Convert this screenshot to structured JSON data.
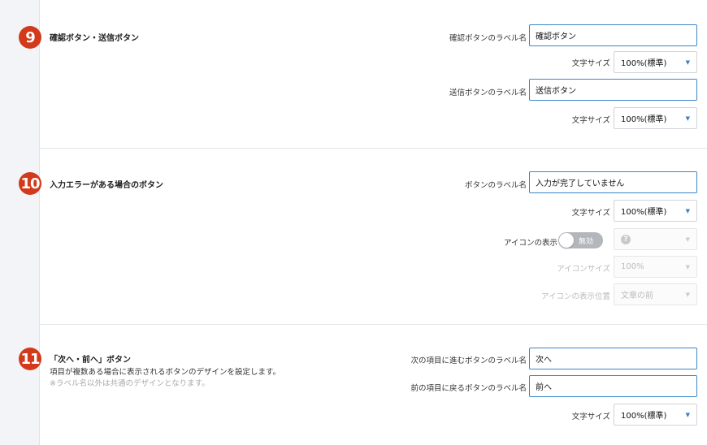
{
  "sections": {
    "s9": {
      "number": "9",
      "title": "確認ボタン・送信ボタン",
      "confirm_label_caption": "確認ボタンのラベル名",
      "confirm_label_value": "確認ボタン",
      "font_size_caption_1": "文字サイズ",
      "font_size_value_1": "100%(標準)",
      "submit_label_caption": "送信ボタンのラベル名",
      "submit_label_value": "送信ボタン",
      "font_size_caption_2": "文字サイズ",
      "font_size_value_2": "100%(標準)"
    },
    "s10": {
      "number": "10",
      "title": "入力エラーがある場合のボタン",
      "button_label_caption": "ボタンのラベル名",
      "button_label_value": "入力が完了していません",
      "font_size_caption": "文字サイズ",
      "font_size_value": "100%(標準)",
      "icon_display_caption": "アイコンの表示",
      "icon_toggle_text": "無効",
      "icon_select_value": "?",
      "icon_size_caption": "アイコンサイズ",
      "icon_size_value": "100%",
      "icon_position_caption": "アイコンの表示位置",
      "icon_position_value": "文章の前"
    },
    "s11": {
      "number": "11",
      "title": "「次へ・前へ」ボタン",
      "description": "項目が複数ある場合に表示されるボタンのデザインを設定します。",
      "note": "※ラベル名以外は共通のデザインとなります。",
      "next_label_caption": "次の項目に進むボタンのラベル名",
      "next_label_value": "次へ",
      "prev_label_caption": "前の項目に戻るボタンのラベル名",
      "prev_label_value": "前へ",
      "font_size_caption": "文字サイズ",
      "font_size_value": "100%(標準)"
    }
  },
  "colors": {
    "badge": "#d3391b",
    "input_border": "#3b86c6",
    "caret": "#3a7fc0"
  },
  "icons": {
    "caret": "caret-down-icon",
    "help": "question-circle-icon"
  }
}
